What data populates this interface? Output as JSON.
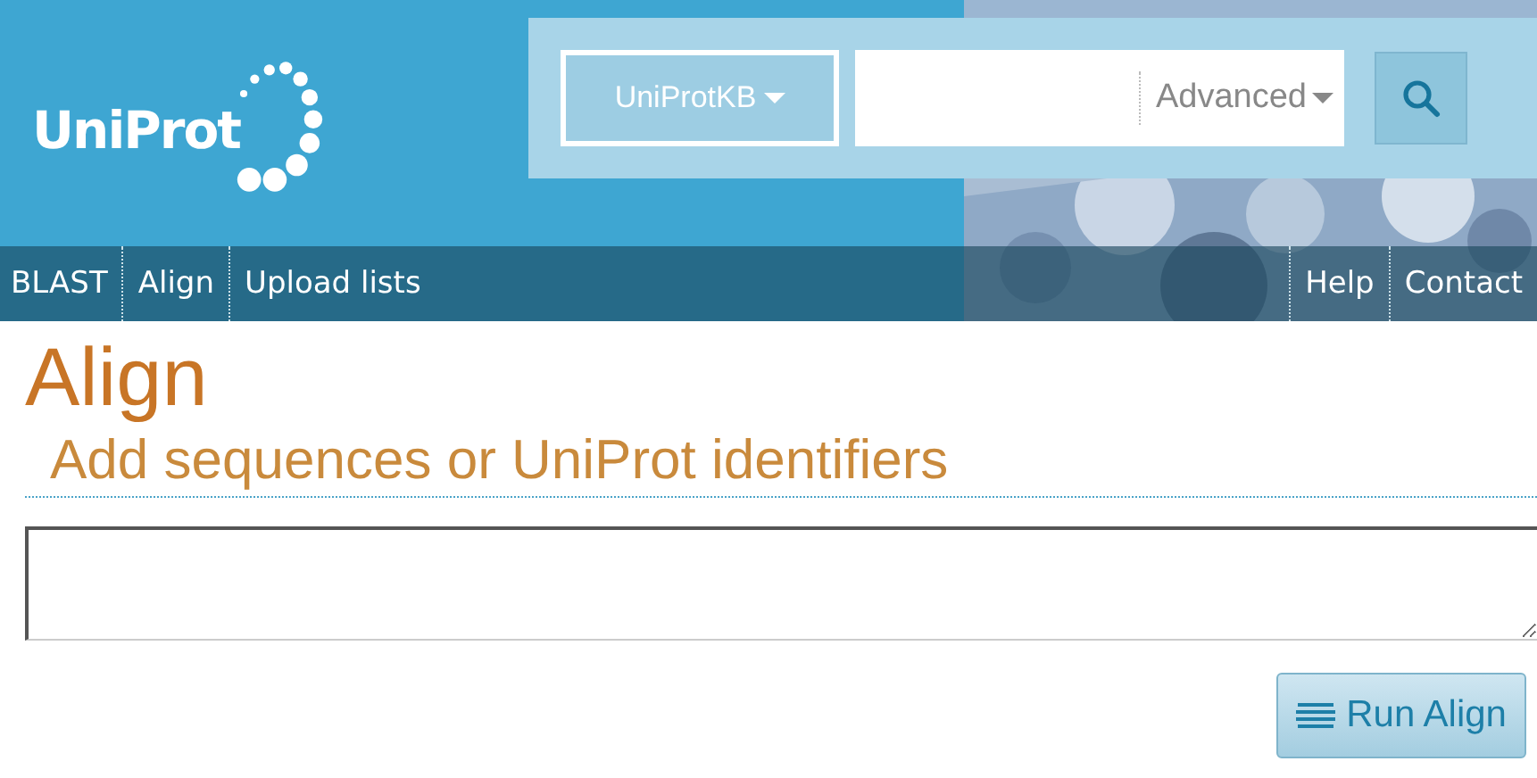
{
  "logo": {
    "text": "UniProt"
  },
  "search": {
    "database": "UniProtKB",
    "advanced": "Advanced"
  },
  "nav": {
    "left": [
      "BLAST",
      "Align",
      "Upload lists"
    ],
    "right": [
      "Help",
      "Contact"
    ]
  },
  "page": {
    "title": "Align",
    "subtitle": "Add sequences or UniProt identifiers"
  },
  "run_button": {
    "label": "Run Align"
  }
}
